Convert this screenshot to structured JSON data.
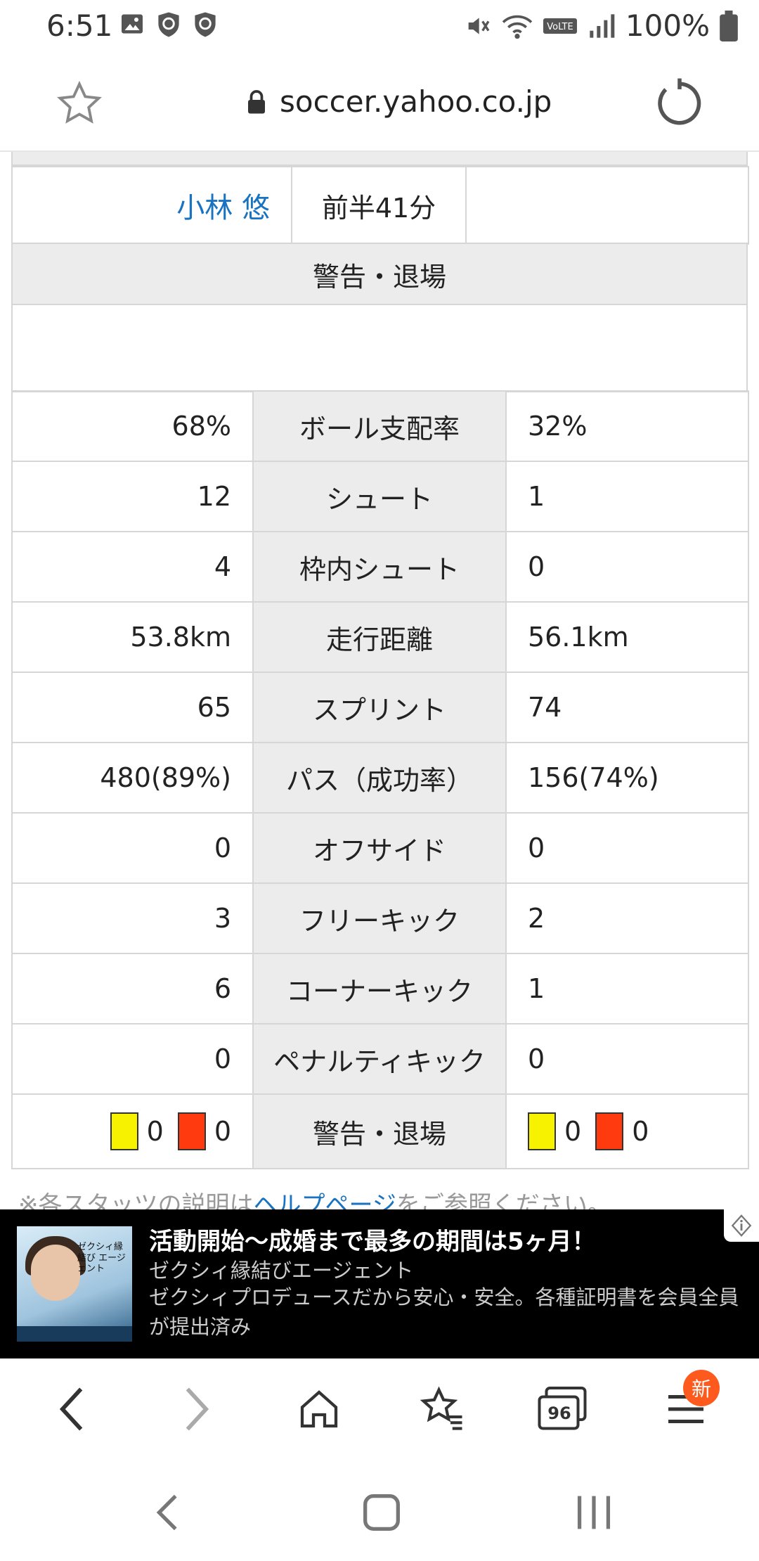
{
  "status_bar": {
    "time": "6:51",
    "battery": "100%",
    "icons_left": [
      "image-icon",
      "shield-icon",
      "shield-icon"
    ],
    "icons_right": [
      "mute-icon",
      "wifi-icon",
      "volte-icon",
      "signal-icon",
      "battery-icon"
    ]
  },
  "browser": {
    "url": "soccer.yahoo.co.jp",
    "tab_count": "96",
    "new_badge": "新"
  },
  "scorer_row": {
    "name": "小林 悠",
    "time": "前半41分"
  },
  "section_title": "警告・退場",
  "stats": [
    {
      "label": "ボール支配率",
      "home": "68%",
      "away": "32%"
    },
    {
      "label": "シュート",
      "home": "12",
      "away": "1"
    },
    {
      "label": "枠内シュート",
      "home": "4",
      "away": "0"
    },
    {
      "label": "走行距離",
      "home": "53.8km",
      "away": "56.1km"
    },
    {
      "label": "スプリント",
      "home": "65",
      "away": "74"
    },
    {
      "label": "パス（成功率）",
      "home": "480(89%)",
      "away": "156(74%)"
    },
    {
      "label": "オフサイド",
      "home": "0",
      "away": "0"
    },
    {
      "label": "フリーキック",
      "home": "3",
      "away": "2"
    },
    {
      "label": "コーナーキック",
      "home": "6",
      "away": "1"
    },
    {
      "label": "ペナルティキック",
      "home": "0",
      "away": "0"
    }
  ],
  "cards_row": {
    "label": "警告・退場",
    "home_yellow": "0",
    "home_red": "0",
    "away_yellow": "0",
    "away_red": "0"
  },
  "note": {
    "prefix": "※各スタッツの説明は",
    "link": "ヘルプページ",
    "suffix": "をご参照ください。"
  },
  "ad": {
    "title": "活動開始〜成婚まで最多の期間は5ヶ月！",
    "sponsor": "ゼクシィ縁結びエージェント",
    "description": "ゼクシィプロデュースだから安心・安全。各種証明書を会員全員が提出済み",
    "image_brand": "ゼクシィ縁結び エージェント"
  }
}
